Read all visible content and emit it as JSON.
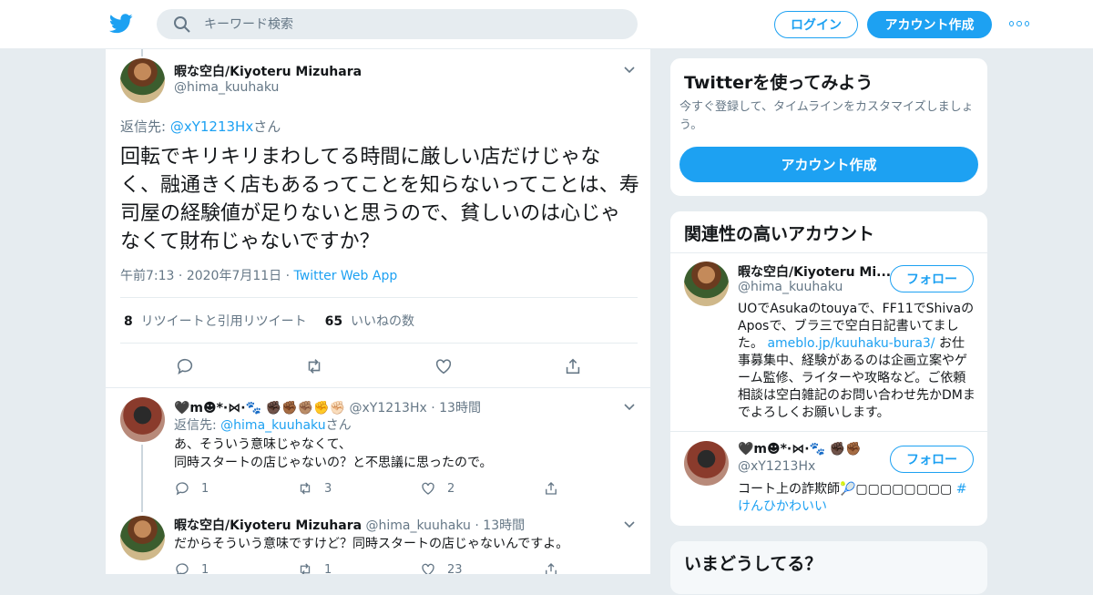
{
  "header": {
    "search_placeholder": "キーワード検索",
    "login_label": "ログイン",
    "signup_label": "アカウント作成"
  },
  "tweet": {
    "author_name": "暇な空白/Kiyoteru Mizuhara",
    "author_handle": "@hima_kuuhaku",
    "reply_prefix": "返信先: ",
    "reply_target": "@xY1213Hx",
    "reply_suffix": "さん",
    "text": "回転でキリキリまわしてる時間に厳しい店だけじゃなく、融通きく店もあるってことを知らないってことは、寿司屋の経験値が足りないと思うので、貧しいのは心じゃなくて財布じゃないですか？",
    "time": "午前7:13",
    "date": "2020年7月11日",
    "app": "Twitter Web App",
    "retweet_count": "8",
    "retweet_label": "リツイートと引用リツイート",
    "like_count": "65",
    "like_label": "いいねの数"
  },
  "replies": [
    {
      "name": "🖤m☻*·⋈·🐾 ✊🏿✊🏾✊🏽✊✊🏻",
      "handle": "@xY1213Hx",
      "time": "13時間",
      "reply_prefix": "返信先: ",
      "reply_target": "@hima_kuuhaku",
      "reply_suffix": "さん",
      "line1": "あ、そういう意味じゃなくて、",
      "line2": "同時スタートの店じゃないの？と不思議に思ったので。",
      "reply_count": "1",
      "retweet_count": "3",
      "like_count": "2"
    },
    {
      "name": "暇な空白/Kiyoteru Mizuhara",
      "handle": "@hima_kuuhaku",
      "time": "13時間",
      "text": "だからそういう意味ですけど？同時スタートの店じゃないんですよ。",
      "reply_count": "1",
      "retweet_count": "1",
      "like_count": "23"
    }
  ],
  "signup_card": {
    "title": "Twitterを使ってみよう",
    "subtitle": "今すぐ登録して、タイムラインをカスタマイズしましょう。",
    "button": "アカウント作成"
  },
  "related": {
    "title": "関連性の高いアカウント",
    "follow_label": "フォロー",
    "accounts": [
      {
        "name": "暇な空白/Kiyoteru Mi...",
        "handle": "@hima_kuuhaku",
        "bio_1": "UOでAsukaのtouyaで、FF11でShivaのAposで、ブラ三で空白日記書いてました。",
        "bio_link": "ameblo.jp/kuuhaku-bura3/",
        "bio_2": " お仕事募集中、経験があるのは企画立案やゲーム監修、ライターや攻略など。ご依頼相談は空白雑記のお問い合わせ先かDMまでよろしくお願いします。"
      },
      {
        "name": "🖤m☻*·⋈·🐾 ✊🏿✊🏾",
        "handle": "@xY1213Hx",
        "bio_1": "コート上の詐欺師🎾▢▢▢▢▢▢▢▢ ",
        "bio_link": "#けんひかわいい",
        "bio_2": ""
      }
    ]
  },
  "whats_happening": {
    "title": "いまどうしてる？"
  },
  "colors": {
    "accent": "#1da1f2",
    "background": "#e6ecf0",
    "muted": "#657786"
  }
}
